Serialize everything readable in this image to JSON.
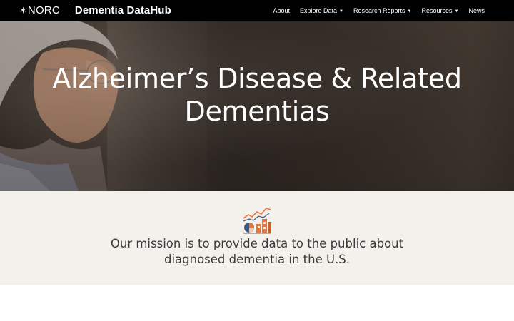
{
  "header": {
    "org_name": "NORC",
    "site_title": "Dementia DataHub",
    "nav": [
      {
        "label": "About",
        "has_dropdown": false
      },
      {
        "label": "Explore Data",
        "has_dropdown": true
      },
      {
        "label": "Research Reports",
        "has_dropdown": true
      },
      {
        "label": "Resources",
        "has_dropdown": true
      },
      {
        "label": "News",
        "has_dropdown": false
      }
    ]
  },
  "hero": {
    "title_line1": "Alzheimer’s Disease & Related",
    "title_line2": "Dementias",
    "image": "photo-elderly-woman-by-window"
  },
  "mission": {
    "icon": "data-chart-illustration-icon",
    "line1": "Our mission is to provide data to the public about",
    "line2": "diagnosed dementia in the U.S."
  },
  "colors": {
    "nav_background": "#000000",
    "nav_text": "#ffffff",
    "mission_background": "#f4f1ec",
    "mission_text": "#3c3c3c",
    "accent_orange": "#e8743b",
    "accent_blue": "#3d5a80"
  }
}
